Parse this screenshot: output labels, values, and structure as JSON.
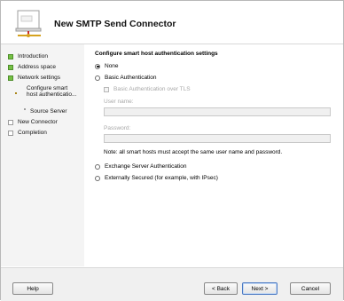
{
  "window": {
    "title": "New SMTP Send Connector"
  },
  "sidebar": {
    "items": [
      {
        "label": "Introduction",
        "state": "done"
      },
      {
        "label": "Address space",
        "state": "done"
      },
      {
        "label": "Network settings",
        "state": "done"
      },
      {
        "label": "Configure smart host authenticatio...",
        "state": "current"
      },
      {
        "label": "Source Server",
        "state": "pending"
      },
      {
        "label": "New Connector",
        "state": "pending"
      },
      {
        "label": "Completion",
        "state": "pending"
      }
    ]
  },
  "main": {
    "title": "Configure smart host authentication settings",
    "options": {
      "none": "None",
      "basic": "Basic Authentication",
      "basic_tls": "Basic Authentication over TLS",
      "exchange": "Exchange Server Authentication",
      "external": "Externally Secured (for example, with IPsec)"
    },
    "selected_option": "None",
    "user_name_label": "User name:",
    "user_name_value": "",
    "password_label": "Password:",
    "password_value": "",
    "note": "Note: all smart hosts must accept the same user name and password."
  },
  "buttons": {
    "help": "Help",
    "back": "< Back",
    "next": "Next >",
    "cancel": "Cancel"
  },
  "colors": {
    "done": "#75c044",
    "current": "#f0c02a",
    "pending": "#ffffff"
  }
}
